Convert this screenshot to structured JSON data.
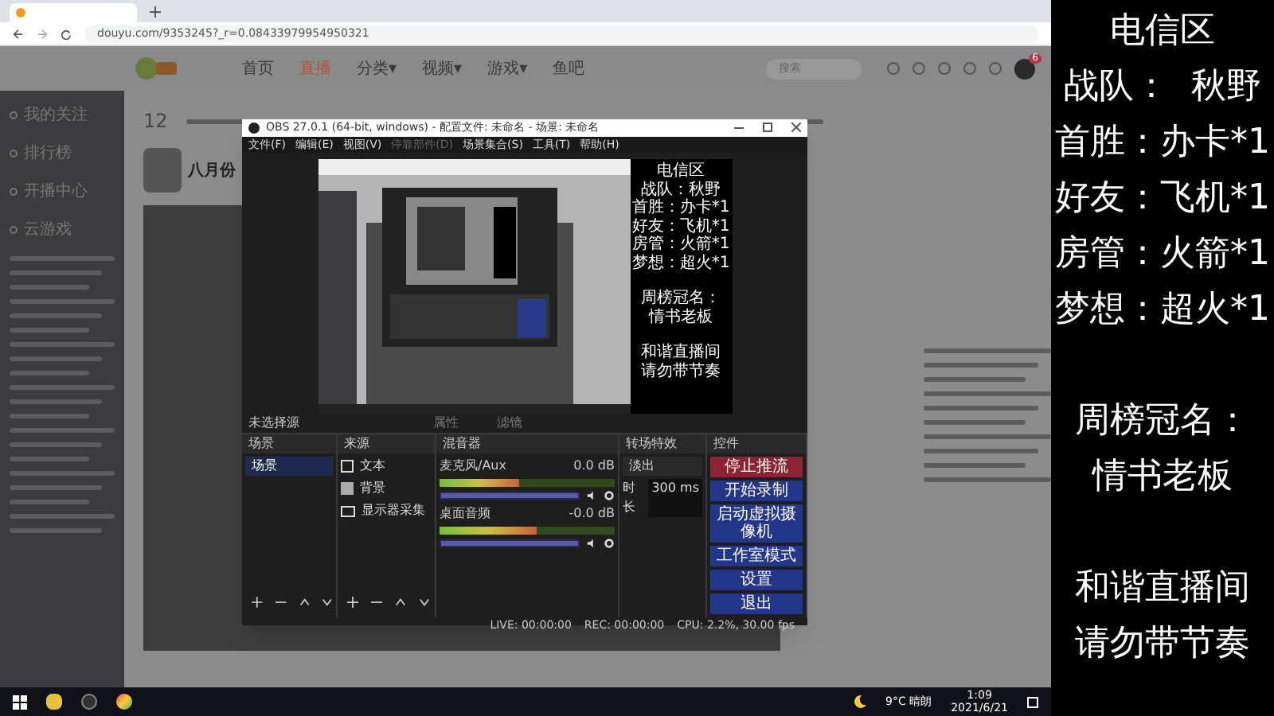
{
  "browser": {
    "address": "douyu.com/9353245?_r=0.08433979954950321",
    "nav": [
      {
        "label": "首页",
        "selected": false
      },
      {
        "label": "直播",
        "selected": true
      },
      {
        "label": "分类▾",
        "selected": false
      },
      {
        "label": "视频▾",
        "selected": false
      },
      {
        "label": "游戏▾",
        "selected": false
      },
      {
        "label": "鱼吧",
        "selected": false
      }
    ],
    "search": {
      "placeholder": "搜索"
    },
    "notification_badge": "6",
    "sidebar": [
      "我的关注",
      "排行榜",
      "开播中心",
      "云游戏"
    ],
    "task_count": "12",
    "streamer_name": "八月份"
  },
  "obs": {
    "title": "OBS 27.0.1 (64-bit, windows) - 配置文件: 未命名 - 场景: 未命名",
    "menu": [
      {
        "label": "文件(F)",
        "disabled": false
      },
      {
        "label": "编辑(E)",
        "disabled": false
      },
      {
        "label": "视图(V)",
        "disabled": false
      },
      {
        "label": "停靠部件(D)",
        "disabled": true
      },
      {
        "label": "场景集合(S)",
        "disabled": false
      },
      {
        "label": "工具(T)",
        "disabled": false
      },
      {
        "label": "帮助(H)",
        "disabled": false
      }
    ],
    "preview_overlay": [
      [
        "电信区",
        "战队：秋野",
        "首胜：办卡*1",
        "好友：飞机*1",
        "房管：火箭*1",
        "梦想：超火*1"
      ],
      [
        "周榜冠名：",
        "情书老板"
      ],
      [
        "和谐直播间",
        "请勿带节奏"
      ]
    ],
    "no_source": "未选择源",
    "properties": "属性",
    "filters": "滤镜",
    "scenes": {
      "title": "场景",
      "items": [
        {
          "label": "场景",
          "selected": true
        }
      ]
    },
    "sources": {
      "title": "来源",
      "items": [
        {
          "label": "文本",
          "kind": "text"
        },
        {
          "label": "背景",
          "kind": "image"
        },
        {
          "label": "显示器采集",
          "kind": "monitor"
        }
      ]
    },
    "mixer": {
      "title": "混音器",
      "channels": [
        {
          "name": "麦克风/Aux",
          "reading": "0.0 dB",
          "meter": {
            "level": 0.45
          },
          "volume": {
            "level": 1
          }
        },
        {
          "name": "桌面音频",
          "reading": "-0.0 dB",
          "meter": {
            "level": 0.55
          },
          "volume": {
            "level": 1
          }
        }
      ]
    },
    "transitions": {
      "title": "转场特效",
      "value": "淡出",
      "duration_label": "时长",
      "duration": "300 ms"
    },
    "controls": {
      "title": "控件",
      "buttons": [
        {
          "label": "停止推流",
          "kind": "stop"
        },
        {
          "label": "开始录制",
          "kind": "normal"
        },
        {
          "label": "启动虚拟摄像机",
          "kind": "normal"
        },
        {
          "label": "工作室模式",
          "kind": "normal"
        },
        {
          "label": "设置",
          "kind": "normal"
        },
        {
          "label": "退出",
          "kind": "normal"
        }
      ]
    },
    "status": {
      "live": "LIVE: 00:00:00",
      "rec": "REC: 00:00:00",
      "cpu": "CPU: 2.2%, 30.00 fps"
    }
  },
  "taskbar": {
    "weather": "9°C 晴朗",
    "time": "1:09",
    "date": "2021/6/21"
  },
  "overlay_panel": [
    [
      "电信区",
      "战队：  秋野",
      "首胜：办卡*1",
      "好友：飞机*1",
      "房管：火箭*1",
      "梦想：超火*1"
    ],
    [
      "周榜冠名：",
      "情书老板"
    ],
    [
      "和谐直播间",
      "请勿带节奏"
    ]
  ]
}
